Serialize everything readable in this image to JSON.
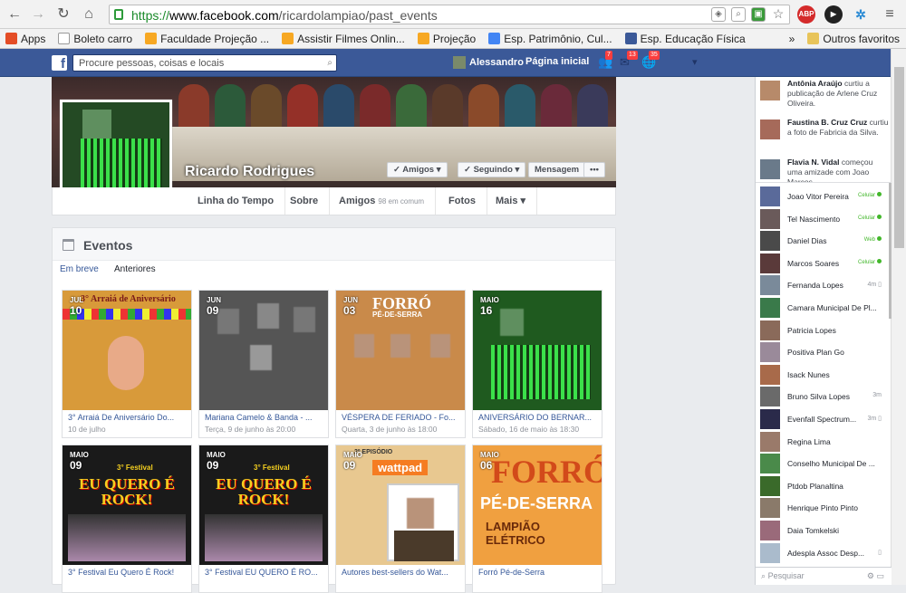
{
  "browser": {
    "url_scheme": "https://",
    "url_domain": "www.facebook.com",
    "url_path": "/ricardolampiao/past_events",
    "bookmarks": [
      {
        "label": "Apps",
        "icon": "apps-grid-icon",
        "color": "#e44d26"
      },
      {
        "label": "Boleto carro",
        "icon": "page-icon",
        "color": "#ffffff"
      },
      {
        "label": "Faculdade Projeção ...",
        "icon": "site-icon",
        "color": "#f7a823"
      },
      {
        "label": "Assistir Filmes Onlin...",
        "icon": "site-icon",
        "color": "#f7a823"
      },
      {
        "label": "Projeção",
        "icon": "site-icon",
        "color": "#f7a823"
      },
      {
        "label": "Esp. Patrimônio, Cul...",
        "icon": "google-icon",
        "color": "#4285f4"
      },
      {
        "label": "Esp. Educação Física",
        "icon": "puzzle-icon",
        "color": "#3b5998"
      }
    ],
    "more_label": "»",
    "other_bookmarks": "Outros favoritos"
  },
  "fb": {
    "search_placeholder": "Procure pessoas, coisas e locais",
    "user_name": "Alessandro",
    "home_label": "Página inicial",
    "friend_requests_count": "7",
    "messages_count": "13",
    "notifications_count": "35"
  },
  "profile": {
    "name": "Ricardo Rodrigues",
    "btn_friends": "✓ Amigos ▾",
    "btn_following": "✓ Seguindo ▾",
    "btn_message": "Mensagem",
    "btn_more": "•••",
    "tabs": [
      {
        "label": "Linha do Tempo",
        "sub": ""
      },
      {
        "label": "Sobre",
        "sub": ""
      },
      {
        "label": "Amigos",
        "sub": "98 em comum"
      },
      {
        "label": "Fotos",
        "sub": ""
      },
      {
        "label": "Mais ▾",
        "sub": ""
      }
    ]
  },
  "events": {
    "title": "Eventos",
    "tab_upcoming": "Em breve",
    "tab_past": "Anteriores",
    "cards": [
      {
        "month": "JUL",
        "day": "10",
        "title": "3° Arraiá De Aniversário Do...",
        "when": "10 de julho",
        "bg": "#d89a3a"
      },
      {
        "month": "JUN",
        "day": "09",
        "title": "Mariana Camelo & Banda - ...",
        "when": "Terça, 9 de junho às 20:00",
        "bg": "#555555"
      },
      {
        "month": "JUN",
        "day": "03",
        "title": "VÉSPERA DE FERIADO - Fo...",
        "when": "Quarta, 3 de junho às 18:00",
        "bg": "#c98a4a"
      },
      {
        "month": "MAIO",
        "day": "16",
        "title": "ANIVERSÁRIO DO BERNAR...",
        "when": "Sábado, 16 de maio às 18:30",
        "bg": "#1f5a1f"
      },
      {
        "month": "MAIO",
        "day": "09",
        "title": "3° Festival Eu Quero É Rock!",
        "when": "",
        "bg": "#1a1a1a"
      },
      {
        "month": "MAIO",
        "day": "09",
        "title": "3° Festival EU QUERO É RO...",
        "when": "",
        "bg": "#1a1a1a"
      },
      {
        "month": "MAIO",
        "day": "09",
        "title": "Autores best-sellers do Wat...",
        "when": "",
        "bg": "#e8c890"
      },
      {
        "month": "MAIO",
        "day": "06",
        "title": "Forró Pé-de-Serra",
        "when": "",
        "bg": "#f0a040"
      }
    ],
    "poster_rock": "EU QUERO É ROCK!",
    "poster_festival": "3° Festival",
    "poster_wattpad": "wattpad",
    "poster_episodio": "2º EPISÓDIO",
    "poster_forro": "FORRÓ",
    "poster_forro2": "PÉ-DE-SERRA",
    "poster_lampiao": "LAMPIÃO ELÉTRICO",
    "poster_arraia": "3° Arraiá de Aniversário",
    "poster_pesesra": "PÉ-DE-SERRA"
  },
  "ticker": [
    {
      "name": "Antônia Araújo",
      "text": " curtiu a publicação de Arlene Cruz Oliveira."
    },
    {
      "name": "Faustina B. Cruz Cruz",
      "text": " curtiu a foto de Fabricia da Silva."
    },
    {
      "name": "Flavia N. Vidal",
      "text": " começou uma amizade com Joao Marcos."
    }
  ],
  "friends": [
    {
      "name": "Joao Vitor Pereira",
      "status": "Celular",
      "type": "mobile"
    },
    {
      "name": "Tel Nascimento",
      "status": "Celular",
      "type": "mobile"
    },
    {
      "name": "Daniel Dias",
      "status": "Web",
      "type": "web"
    },
    {
      "name": "Marcos Soares",
      "status": "Celular",
      "type": "mobile"
    },
    {
      "name": "Fernanda Lopes",
      "status": "4m ▯",
      "type": "time"
    },
    {
      "name": "Camara Municipal De Pl...",
      "status": "",
      "type": "none"
    },
    {
      "name": "Patricia Lopes",
      "status": "",
      "type": "none"
    },
    {
      "name": "Positiva Plan Go",
      "status": "",
      "type": "none"
    },
    {
      "name": "Isack Nunes",
      "status": "",
      "type": "none"
    },
    {
      "name": "Bruno Silva Lopes",
      "status": "3m",
      "type": "time"
    },
    {
      "name": "Evenfall Spectrum...",
      "status": "3m ▯",
      "type": "time"
    },
    {
      "name": "Regina Lima",
      "status": "",
      "type": "none"
    },
    {
      "name": "Conselho Municipal De ...",
      "status": "",
      "type": "none"
    },
    {
      "name": "Ptdob Planaltina",
      "status": "",
      "type": "none"
    },
    {
      "name": "Henrique Pinto Pinto",
      "status": "",
      "type": "none"
    },
    {
      "name": "Daia Tomkelski",
      "status": "",
      "type": "none"
    },
    {
      "name": "Adespla Assoc Desp...",
      "status": "▯",
      "type": "time"
    }
  ],
  "chat_search_placeholder": "Pesquisar"
}
